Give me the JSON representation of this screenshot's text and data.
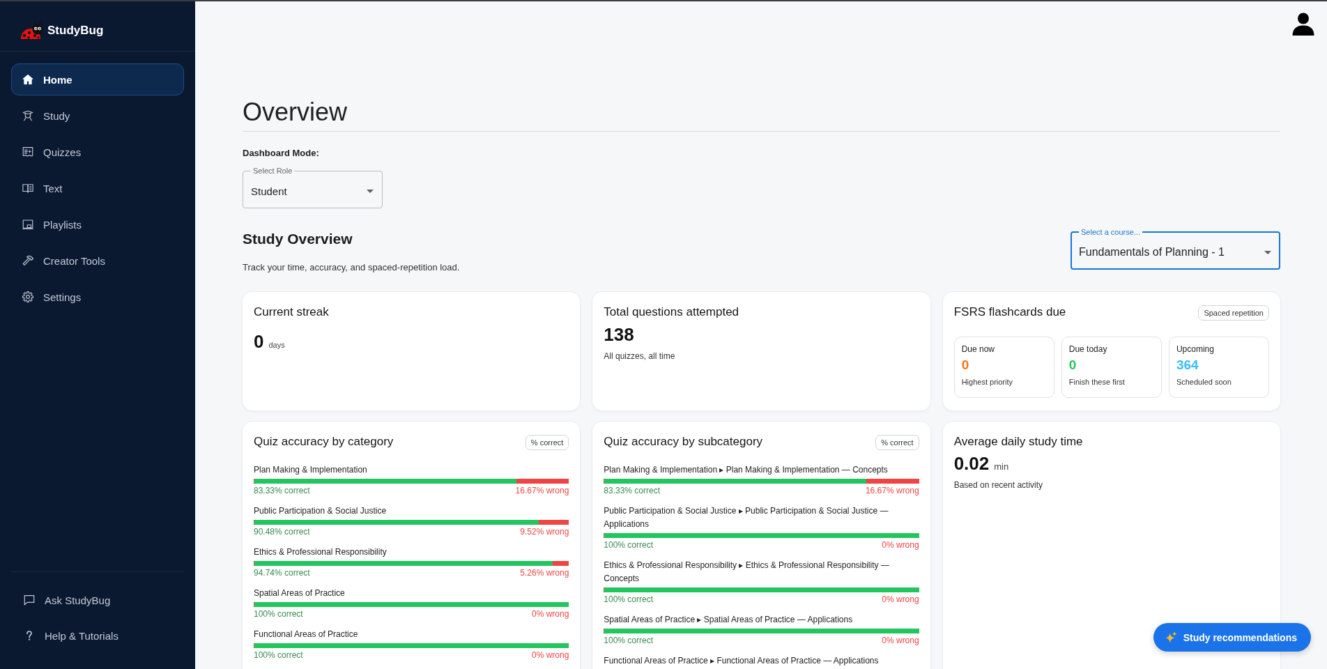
{
  "sidebar": {
    "brand": "StudyBug",
    "nav_items": [
      {
        "label": "Home",
        "selected": true
      },
      {
        "label": "Study",
        "selected": false
      },
      {
        "label": "Quizzes",
        "selected": false
      },
      {
        "label": "Text",
        "selected": false
      },
      {
        "label": "Playlists",
        "selected": false
      },
      {
        "label": "Creator Tools",
        "selected": false
      },
      {
        "label": "Settings",
        "selected": false
      }
    ],
    "footer_items": [
      {
        "label": "Ask StudyBug"
      },
      {
        "label": "Help & Tutorials"
      }
    ]
  },
  "page": {
    "title": "Overview",
    "mode_label": "Dashboard Mode:",
    "role_select": {
      "label": "Select Role",
      "value": "Student"
    }
  },
  "study_overview": {
    "title": "Study Overview",
    "subtitle": "Track your time, accuracy, and spaced-repetition load.",
    "course_select": {
      "label": "Select a course...",
      "value": "Fundamentals of Planning - 1",
      "focused": true
    }
  },
  "stats": [
    {
      "kind": "streak",
      "title": "Current streak",
      "value": "0",
      "unit": "days"
    },
    {
      "kind": "total",
      "title": "Total questions attempted",
      "value": "138",
      "note": "All quizzes, all time"
    },
    {
      "kind": "due",
      "title": "FSRS flashcards due",
      "tag": "Spaced repetition",
      "tiles": [
        {
          "label": "Due now",
          "value": "0",
          "note": "Highest priority",
          "color": "#f97316"
        },
        {
          "label": "Due today",
          "value": "0",
          "note": "Finish these first",
          "color": "#22c55e"
        },
        {
          "label": "Upcoming",
          "value": "364",
          "note": "Scheduled soon",
          "color": "#38bdf8"
        }
      ]
    }
  ],
  "panels": [
    {
      "kind": "accuracy",
      "title": "Quiz accuracy by category",
      "tag": "% correct",
      "rows": [
        {
          "label": "Plan Making & Implementation",
          "level": 0.8333,
          "correct": "83.33% correct",
          "wrong": "16.67% wrong"
        },
        {
          "label": "Public Participation & Social Justice",
          "level": 0.9048,
          "correct": "90.48% correct",
          "wrong": "9.52% wrong"
        },
        {
          "label": "Ethics & Professional Responsibility",
          "level": 0.9474,
          "correct": "94.74% correct",
          "wrong": "5.26% wrong"
        },
        {
          "label": "Spatial Areas of Practice",
          "level": 1,
          "correct": "100% correct",
          "wrong": "0% wrong"
        },
        {
          "label": "Functional Areas of Practice",
          "level": 1,
          "correct": "100% correct",
          "wrong": "0% wrong"
        }
      ]
    },
    {
      "kind": "accuracy",
      "title": "Quiz accuracy by subcategory",
      "tag": "% correct",
      "rows": [
        {
          "label": "Plan Making & Implementation ▸ Plan Making & Implementation — Concepts",
          "level": 0.8333,
          "correct": "83.33% correct",
          "wrong": "16.67% wrong"
        },
        {
          "label": "Public Participation & Social Justice ▸ Public Participation & Social Justice — Applications",
          "level": 1,
          "correct": "100% correct",
          "wrong": "0% wrong"
        },
        {
          "label": "Ethics & Professional Responsibility ▸ Ethics & Professional Responsibility — Concepts",
          "level": 1,
          "correct": "100% correct",
          "wrong": "0% wrong"
        },
        {
          "label": "Spatial Areas of Practice ▸ Spatial Areas of Practice — Applications",
          "level": 1,
          "correct": "100% correct",
          "wrong": "0% wrong"
        },
        {
          "label": "Functional Areas of Practice ▸ Functional Areas of Practice — Applications"
        }
      ]
    },
    {
      "kind": "average",
      "title": "Average daily study time",
      "value": "0.02",
      "unit": "min",
      "note": "Based on recent activity"
    }
  ],
  "fab": {
    "label": "Study recommendations"
  }
}
